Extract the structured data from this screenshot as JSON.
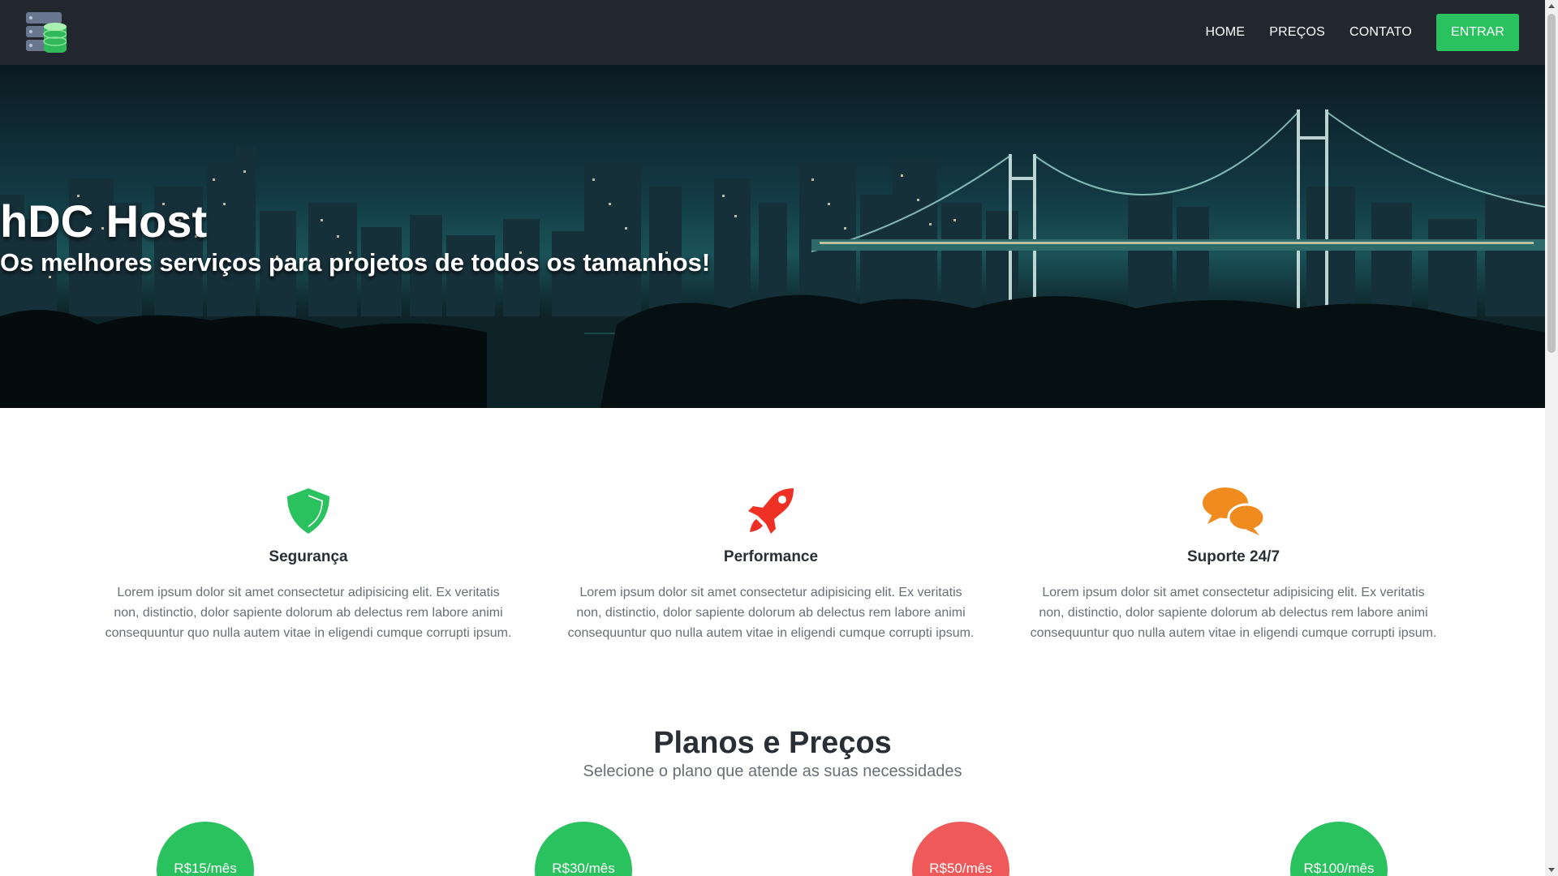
{
  "nav": {
    "logo_icon": "database-server-icon",
    "links": [
      {
        "label": "HOME"
      },
      {
        "label": "PREÇOS"
      },
      {
        "label": "CONTATO"
      }
    ],
    "cta_label": "ENTRAR"
  },
  "hero": {
    "title": "hDC Host",
    "subtitle": "Os melhores serviços para projetos de todos os tamanhos!",
    "background": "night-city-bridge-image"
  },
  "features": [
    {
      "icon": "shield-icon",
      "color": "#2ac25f",
      "title": "Segurança",
      "text": "Lorem ipsum dolor sit amet consectetur adipisicing elit. Ex veritatis non, distinctio, dolor sapiente dolorum ab delectus rem labore animi consequuntur quo nulla autem vitae in eligendi cumque corrupti ipsum."
    },
    {
      "icon": "rocket-icon",
      "color": "#ee3124",
      "title": "Performance",
      "text": "Lorem ipsum dolor sit amet consectetur adipisicing elit. Ex veritatis non, distinctio, dolor sapiente dolorum ab delectus rem labore animi consequuntur quo nulla autem vitae in eligendi cumque corrupti ipsum."
    },
    {
      "icon": "chat-bubbles-icon",
      "color": "#f08b1f",
      "title": "Suporte 24/7",
      "text": "Lorem ipsum dolor sit amet consectetur adipisicing elit. Ex veritatis non, distinctio, dolor sapiente dolorum ab delectus rem labore animi consequuntur quo nulla autem vitae in eligendi cumque corrupti ipsum."
    }
  ],
  "pricing": {
    "title": "Planos e Preços",
    "subtitle": "Selecione o plano que atende as suas necessidades",
    "plans": [
      {
        "price": "R$15/mês",
        "color": "#2ac25f"
      },
      {
        "price": "R$30/mês",
        "color": "#2ac25f"
      },
      {
        "price": "R$50/mês",
        "color": "#f0595a"
      },
      {
        "price": "R$100/mês",
        "color": "#2ac25f"
      }
    ]
  },
  "colors": {
    "navbar_bg": "#22272f",
    "accent_green": "#2ac25f"
  }
}
